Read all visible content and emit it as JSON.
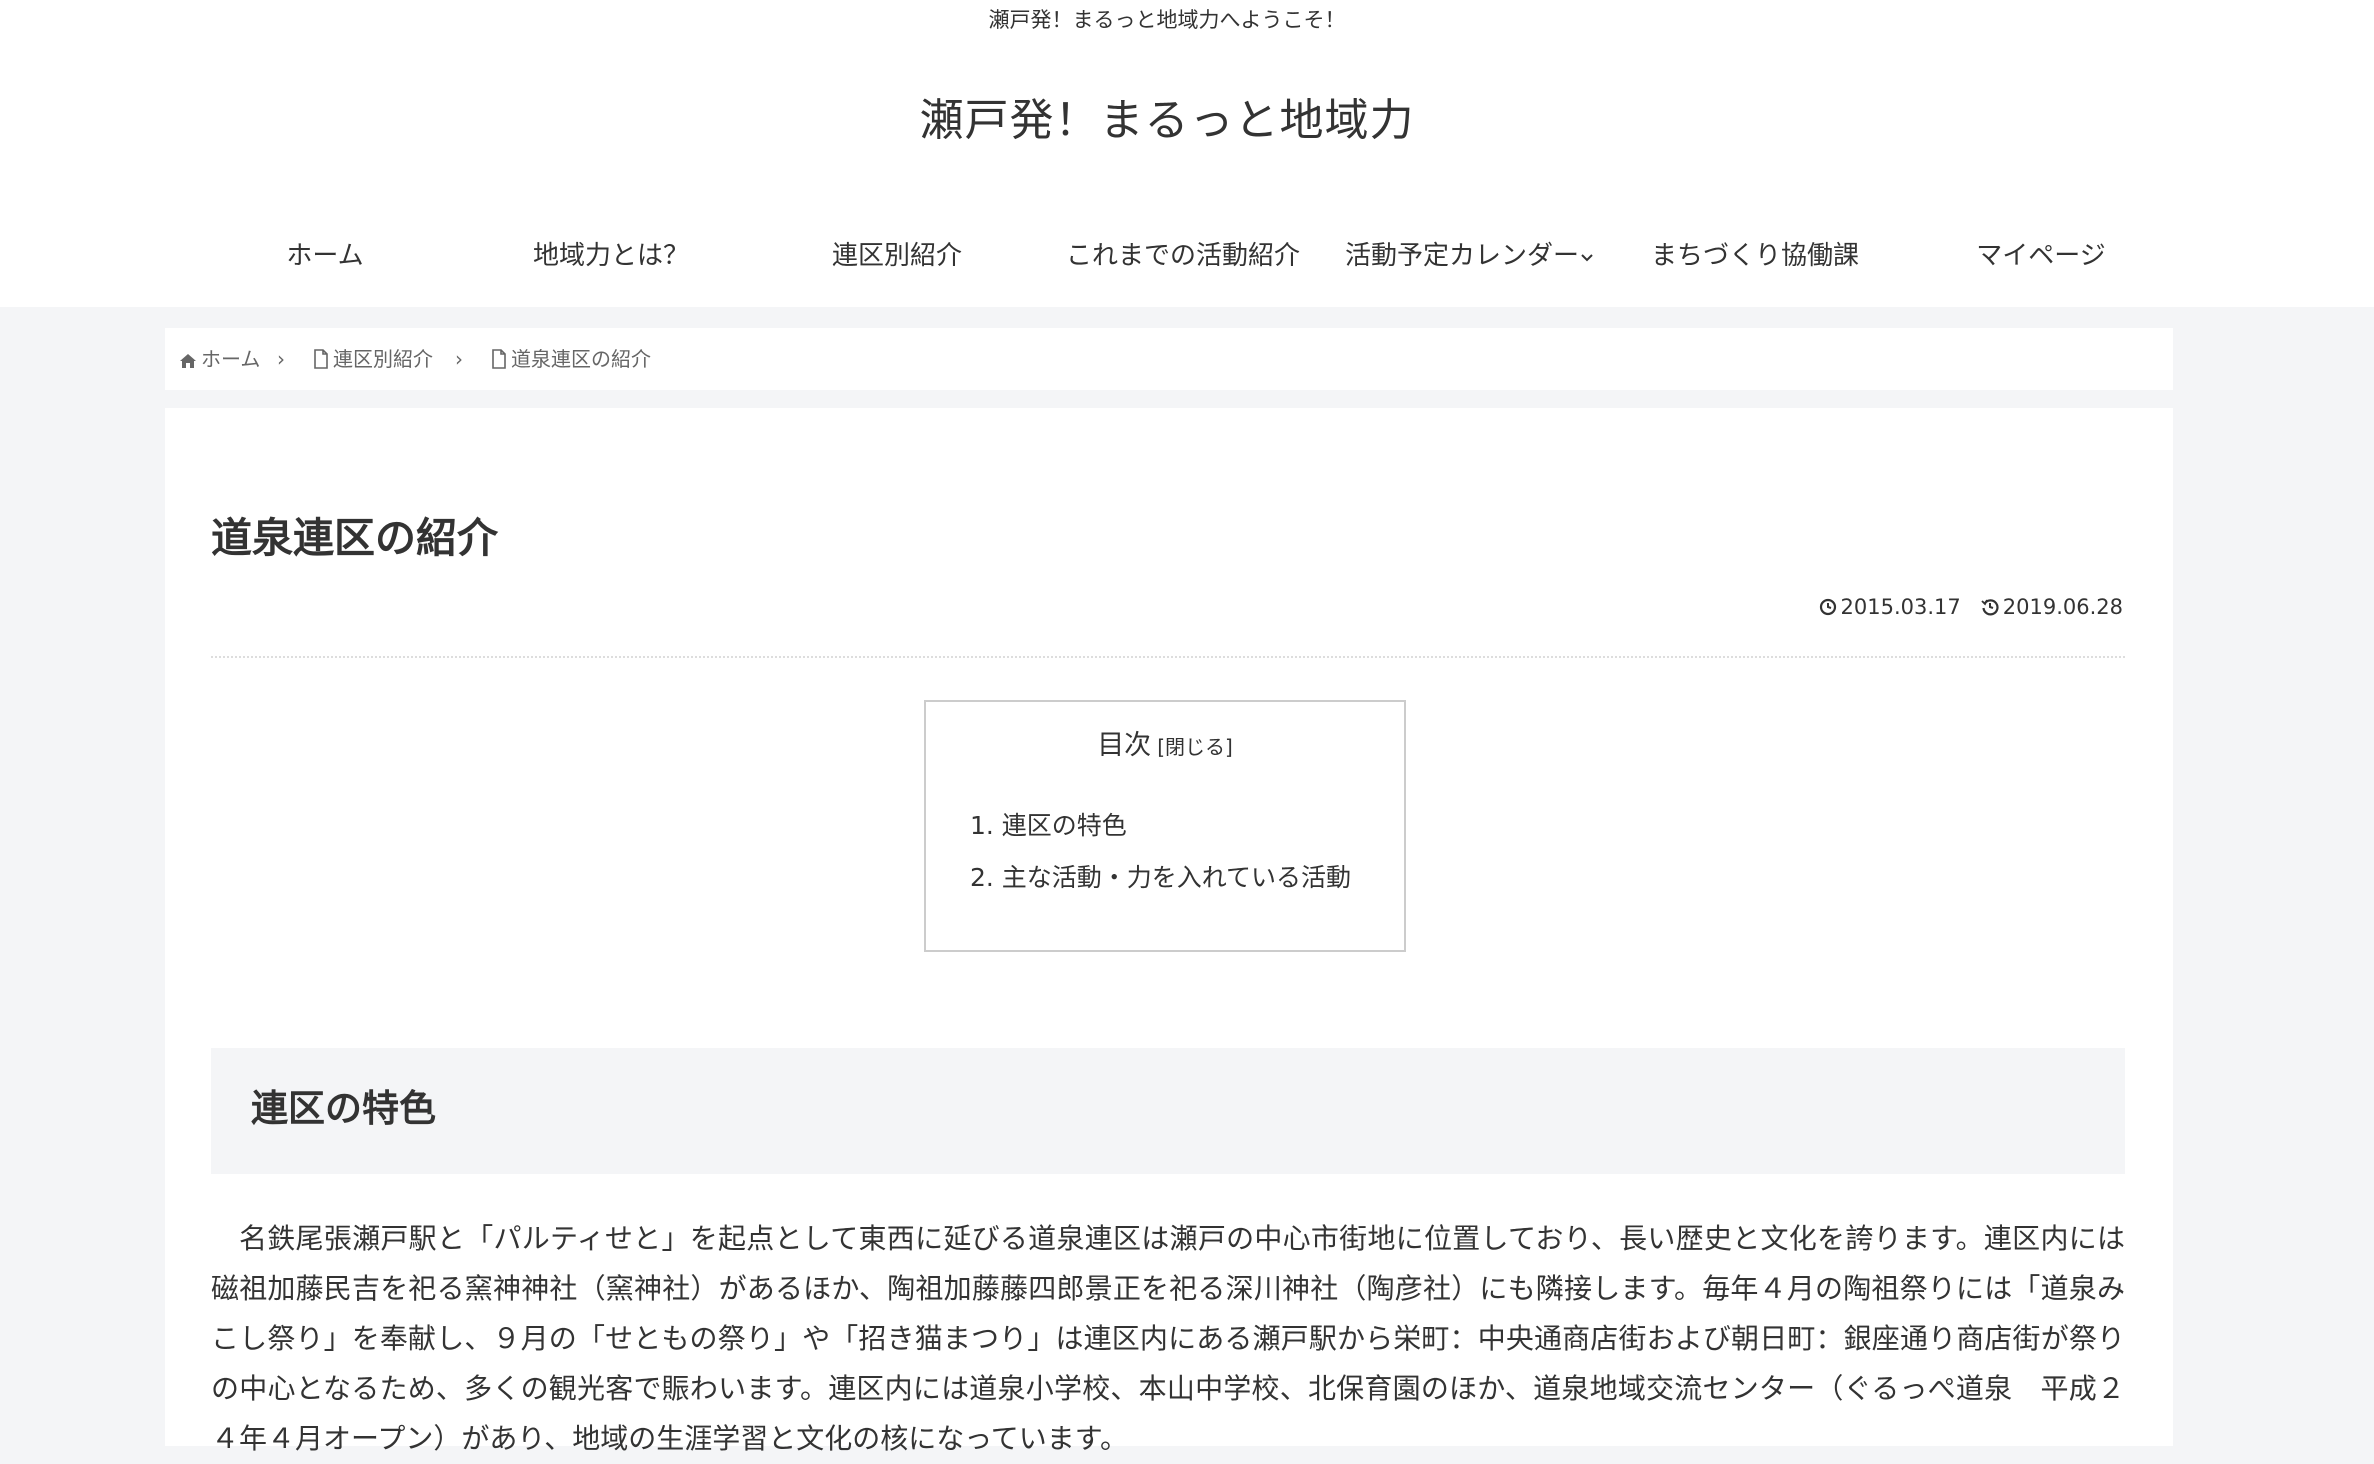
{
  "header": {
    "tagline": "瀬戸発！まるっと地域力へようこそ！",
    "site_title": "瀬戸発！まるっと地域力"
  },
  "nav": {
    "items": [
      {
        "label": "ホーム"
      },
      {
        "label": "地域力とは？"
      },
      {
        "label": "連区別紹介"
      },
      {
        "label": "これまでの活動紹介"
      },
      {
        "label": "活動予定カレンダー"
      },
      {
        "label": "まちづくり協働課"
      },
      {
        "label": "マイページ"
      }
    ]
  },
  "breadcrumb": {
    "items": [
      {
        "label": "ホーム",
        "icon": "home-icon"
      },
      {
        "label": "連区別紹介",
        "icon": "file-icon"
      },
      {
        "label": "道泉連区の紹介",
        "icon": "file-icon"
      }
    ],
    "separator": "›"
  },
  "article": {
    "title": "道泉連区の紹介",
    "posted_date": "2015.03.17",
    "updated_date": "2019.06.28",
    "toc": {
      "title": "目次",
      "toggle": "[閉じる]",
      "items": [
        "1. 連区の特色",
        "2. 主な活動・力を入れている活動"
      ]
    },
    "section": {
      "heading": "連区の特色",
      "paragraph": "名鉄尾張瀬戸駅と「パルティせと」を起点として東西に延びる道泉連区は瀬戸の中心市街地に位置しており、長い歴史と文化を誇ります。連区内には磁祖加藤民吉を祀る窯神神社（窯神社）があるほか、陶祖加藤藤四郎景正を祀る深川神社（陶彦社）にも隣接します。毎年４月の陶祖祭りには「道泉みこし祭り」を奉献し、９月の「せともの祭り」や「招き猫まつり」は連区内にある瀬戸駅から栄町：中央通商店街および朝日町：銀座通り商店街が祭りの中心となるため、多くの観光客で賑わいます。連区内には道泉小学校、本山中学校、北保育園のほか、道泉地域交流センター（ぐるっぺ道泉　平成２４年４月オープン）があり、地域の生涯学習と文化の核になっています。"
    }
  },
  "colors": {
    "page_background": "#f4f5f7",
    "card_background": "#ffffff",
    "text": "#333333",
    "muted_text": "#666666",
    "toc_border": "#cccccc"
  }
}
